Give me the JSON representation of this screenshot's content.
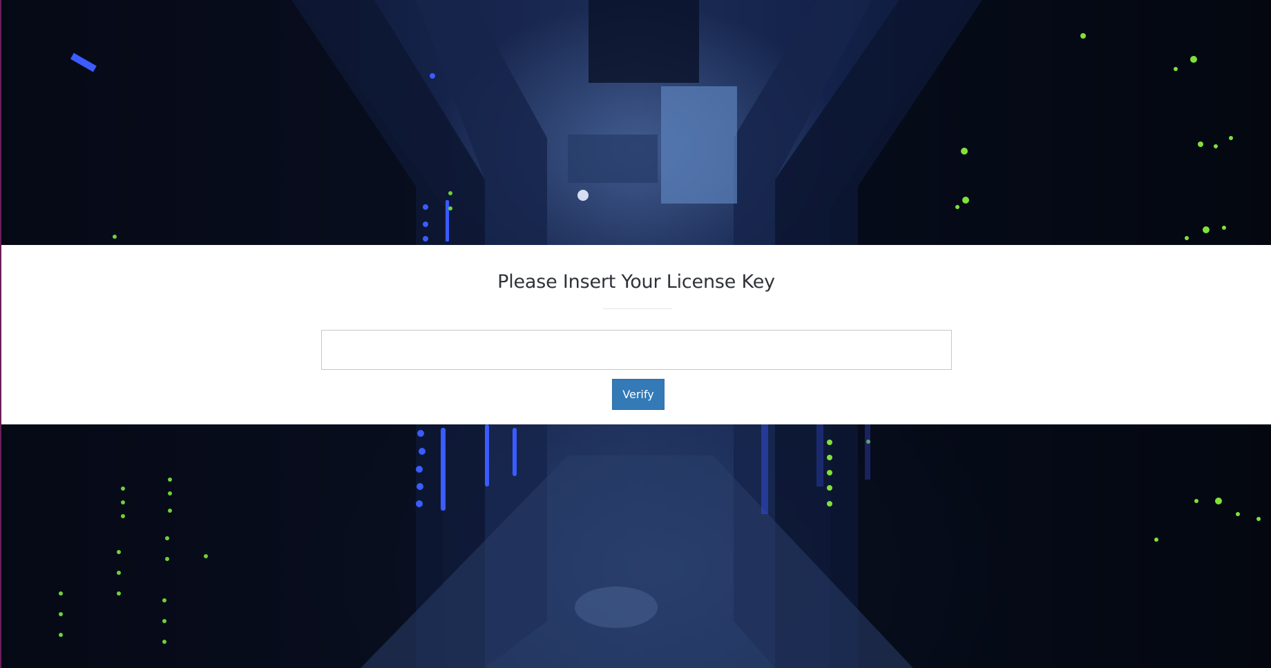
{
  "page": {
    "title": "Please Insert Your License Key"
  },
  "license_form": {
    "input_value": "",
    "input_placeholder": "",
    "verify_label": "Verify"
  },
  "colors": {
    "button_primary": "#337ab7",
    "panel_background": "#ffffff",
    "background_tone": "#1c2c55"
  }
}
